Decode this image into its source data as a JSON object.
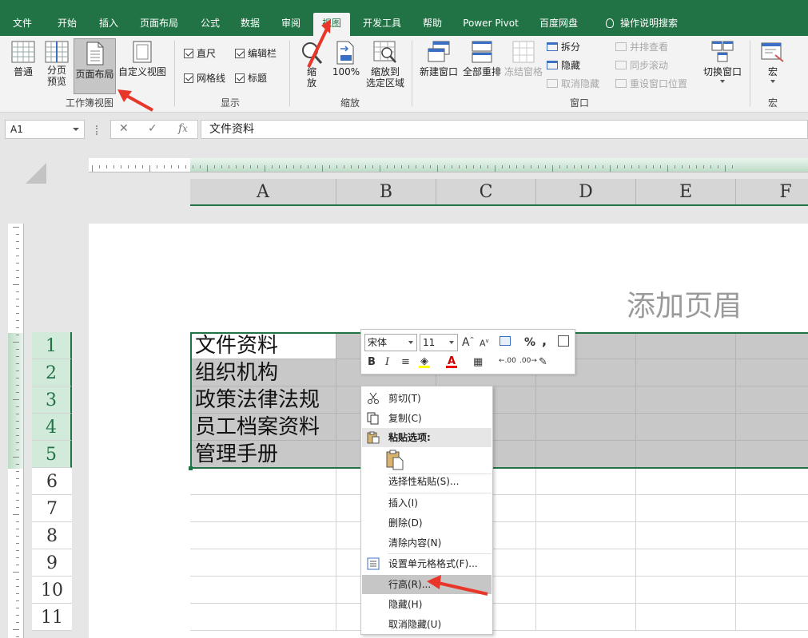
{
  "tabs": [
    "文件",
    "开始",
    "插入",
    "页面布局",
    "公式",
    "数据",
    "审阅",
    "视图",
    "开发工具",
    "帮助",
    "Power Pivot",
    "百度网盘",
    "操作说明搜索"
  ],
  "active_tab": "视图",
  "ribbon": {
    "workbook_views": {
      "normal": "普通",
      "page_break_1": "分页",
      "page_break_2": "预览",
      "page_layout": "页面布局",
      "custom_views": "自定义视图",
      "group_label": "工作簿视图"
    },
    "show": {
      "ruler": "直尺",
      "formula_bar": "编辑栏",
      "gridlines": "网格线",
      "headings": "标题",
      "group_label": "显示"
    },
    "zoom": {
      "zoom_1": "缩",
      "zoom_2": "放",
      "hundred": "100%",
      "zoom_sel_1": "缩放到",
      "zoom_sel_2": "选定区域",
      "group_label": "缩放"
    },
    "window": {
      "new_window": "新建窗口",
      "arrange_all": "全部重排",
      "freeze_panes": "冻结窗格",
      "split": "拆分",
      "hide": "隐藏",
      "unhide": "取消隐藏",
      "side_by_side": "并排查看",
      "sync_scroll": "同步滚动",
      "reset_pos": "重设窗口位置",
      "switch_windows": "切换窗口",
      "group_label": "窗口"
    },
    "macros": {
      "macros": "宏",
      "group_label": "宏"
    }
  },
  "formula_bar": {
    "name_box": "A1",
    "content": "文件资料"
  },
  "columns": [
    "A",
    "B",
    "C",
    "D",
    "E",
    "F"
  ],
  "rows": [
    "1",
    "2",
    "3",
    "4",
    "5",
    "6",
    "7",
    "8",
    "9",
    "10",
    "11"
  ],
  "cells": [
    "文件资料",
    "组织机构",
    "政策法律法规",
    "员工档案资料",
    "管理手册"
  ],
  "page_header_placeholder": "添加页眉",
  "mini_toolbar": {
    "font_name": "宋体",
    "font_size": "11"
  },
  "context_menu": {
    "cut": "剪切(T)",
    "copy": "复制(C)",
    "paste_options": "粘贴选项:",
    "paste_special": "选择性粘贴(S)...",
    "insert": "插入(I)",
    "delete": "删除(D)",
    "clear_contents": "清除内容(N)",
    "format_cells": "设置单元格格式(F)...",
    "row_height": "行高(R)...",
    "hide": "隐藏(H)",
    "unhide": "取消隐藏(U)"
  },
  "colors": {
    "excel_green": "#217346",
    "annotation_red": "#e8362a"
  },
  "icons": [
    "lightbulb-icon",
    "normal-view-icon",
    "page-break-preview-icon",
    "page-layout-icon",
    "custom-views-icon",
    "zoom-icon",
    "zoom-100-icon",
    "zoom-selection-icon",
    "new-window-icon",
    "arrange-all-icon",
    "freeze-panes-icon",
    "split-icon",
    "hide-icon",
    "unhide-icon",
    "side-by-side-icon",
    "sync-scroll-icon",
    "reset-window-icon",
    "switch-windows-icon",
    "macros-icon",
    "cancel-icon",
    "enter-icon",
    "fx-icon",
    "scissors-icon",
    "copy-icon",
    "paste-icon",
    "format-cells-icon"
  ]
}
